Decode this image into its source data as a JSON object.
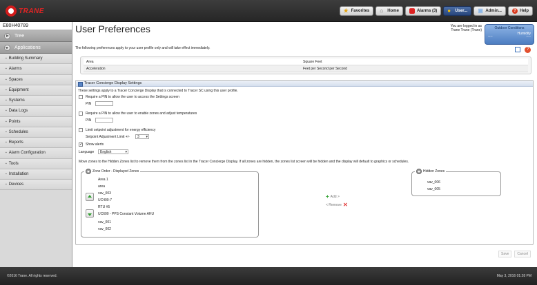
{
  "brand": {
    "logo_text": "TRANE"
  },
  "topnav": {
    "items": [
      {
        "label": "Favorites",
        "icon": "star-icon"
      },
      {
        "label": "Home",
        "icon": "home-icon"
      },
      {
        "label": "Alarms (3)",
        "icon": "alarm-icon"
      },
      {
        "label": "User...",
        "icon": "user-icon",
        "active": true
      },
      {
        "label": "Admin...",
        "icon": "admin-icon"
      },
      {
        "label": "Help",
        "icon": "help-icon"
      }
    ]
  },
  "sidebar": {
    "site_name": "E80H40789",
    "tree_label": "Tree",
    "applications_label": "Applications",
    "items": [
      "Building Summary",
      "Alarms",
      "Spaces",
      "Equipment",
      "Systems",
      "Data Logs",
      "Points",
      "Schedules",
      "Reports",
      "Alarm Configuration",
      "Tools",
      "Installation",
      "Devices"
    ]
  },
  "header": {
    "title": "User Preferences",
    "logged_in_line1": "You are logged in as",
    "logged_in_line2": "Trane Trane (Trane)",
    "outdoor": {
      "title": "Outdoor Conditions",
      "humidity_label": "Humidity",
      "value1": "----",
      "value2": "----"
    }
  },
  "intro_text": "The following preferences apply to your user profile only and will take effect immediately.",
  "preferences": [
    {
      "name": "Area",
      "value": "Square Feet"
    },
    {
      "name": "Acceleration",
      "value": "Feet per Second per Second"
    }
  ],
  "concierge": {
    "title": "Tracer Concierge Display Settings",
    "description": "These settings apply to a Tracer Concierge Display that is connected to Tracer SC using this user profile.",
    "pin_settings_label": "Require a PIN to allow the user to access the Settings screen",
    "pin_label": "PIN",
    "pin_zones_label": "Require a PIN to allow the user to enable zones and adjust temperatures",
    "limit_label": "Limit setpoint adjustment for energy efficiency",
    "setpoint_limit_label": "Setpoint Adjustment Limit +/-",
    "setpoint_limit_value": "3",
    "show_alerts_label": "Show alerts",
    "language_label": "Language",
    "language_value": "English",
    "move_instructions": "Move zones to the Hidden Zones list to remove them from the zones list in the Tracer Concierge Display. If all zones are hidden, the zones list screen will be hidden and the display will default to graphics or schedules.",
    "displayed_title": "Zone Order - Displayed Zones",
    "displayed_zones": [
      "Area 1",
      "area",
      "vav_003",
      "UC400-7",
      "RTU #5",
      "UC600 - PPS Constant Volume AHU",
      "vav_001",
      "vav_002"
    ],
    "hidden_title": "Hidden Zones",
    "hidden_zones": [
      "vav_006",
      "vav_005"
    ],
    "add_label": "Add >",
    "remove_label": "< Remove"
  },
  "actions": {
    "save": "Save",
    "cancel": "Cancel"
  },
  "footer": {
    "copyright": "©2016 Trane. All rights reserved.",
    "date": "May 3, 2016 01:28 PM"
  }
}
